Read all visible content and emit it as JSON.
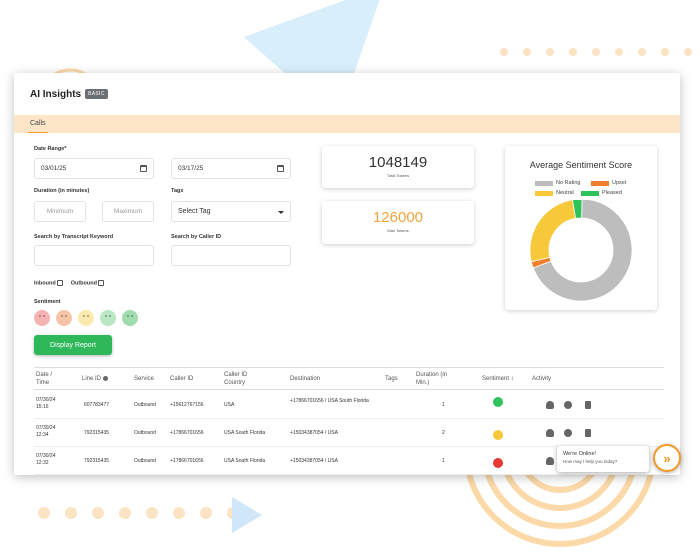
{
  "app": {
    "title": "AI Insights",
    "badge": "BASIC",
    "tabs": [
      {
        "label": "Calls",
        "active": true
      }
    ]
  },
  "filters": {
    "date_range_label": "Date Range*",
    "date_from": "03/01/25",
    "date_to": "03/17/25",
    "duration_label": "Duration (in minutes)",
    "duration_min_placeholder": "Minimum",
    "duration_max_placeholder": "Maximum",
    "tags_label": "Tags",
    "tags_value": "Select Tag",
    "transcript_label": "Search by Transcript Keyword",
    "caller_label": "Search by Caller ID",
    "inbound_label": "Inbound",
    "outbound_label": "Outbound",
    "sentiment_label": "Sentiment",
    "sentiment_options": [
      "upset",
      "annoyed",
      "neutral",
      "satisfied",
      "pleased"
    ],
    "display_button": "Display Report"
  },
  "stats": {
    "total_value": "1048149",
    "total_label": "Total Tokens",
    "max_value": "126000",
    "max_label": "Max Tokens",
    "max_color": "#f0a43a"
  },
  "chart_data": {
    "type": "pie",
    "title": "Average Sentiment Score",
    "legend": [
      "No Rating",
      "Upset",
      "Neutral",
      "Pleased"
    ],
    "colors": [
      "#bdbdbd",
      "#f07e2a",
      "#f7c83a",
      "#2fc35a"
    ],
    "values": [
      69,
      2,
      26,
      3
    ],
    "donut": true
  },
  "table": {
    "headers": [
      "Date / Time",
      "Line ID",
      "Service",
      "Caller ID",
      "Caller ID Country",
      "Destination",
      "Tags",
      "Duration (in Min.)",
      "Sentiment",
      "Activity"
    ],
    "rows": [
      {
        "date": "07/30/24",
        "time": "15:16",
        "line_id": "607783477",
        "service": "Outbound",
        "caller_id": "+15612767156",
        "country": "USA",
        "destination": "+17866701656 / USA South Florida",
        "tags": "",
        "duration": "1",
        "sentiment_color": "#2fc35a"
      },
      {
        "date": "07/30/24",
        "time": "12:34",
        "line_id": "792315435",
        "service": "Outbound",
        "caller_id": "+17866701656",
        "country": "USA South Florida",
        "destination": "+15034387054 / USA",
        "tags": "",
        "duration": "2",
        "sentiment_color": "#f7c83a"
      },
      {
        "date": "07/30/24",
        "time": "12:32",
        "line_id": "792315435",
        "service": "Outbound",
        "caller_id": "+17866701656",
        "country": "USA South Florida",
        "destination": "+15034387054 / USA",
        "tags": "",
        "duration": "1",
        "sentiment_color": "#e53935"
      }
    ]
  },
  "chat": {
    "title": "We're Online!",
    "subtitle": "How may I help you today?"
  }
}
